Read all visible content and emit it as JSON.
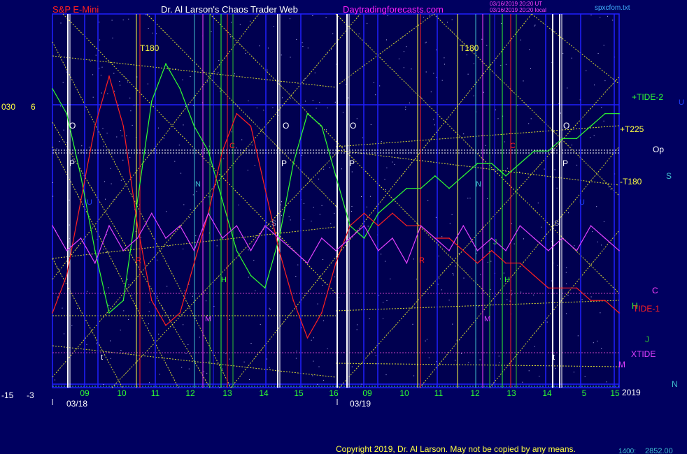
{
  "header": {
    "instrument": "S&P E-Mini",
    "site_title": "Dr. Al Larson's Chaos Trader Web",
    "site_url": "Daytradingforecasts.com",
    "timestamp_1": "03/16/2019 20:20 UT",
    "timestamp_2": "03/16/2019 20:20 local",
    "file_name": "spxcfom.txt"
  },
  "left_axis": {
    "top_labels": [
      "030",
      "6"
    ],
    "bottom_labels": [
      "-15",
      "-3"
    ]
  },
  "right_labels": {
    "tide2": "+TIDE-2",
    "t225": "+T225",
    "op": "Op",
    "t180": "-T180",
    "s": "S",
    "u": "U",
    "c": "C",
    "h": "H",
    "tide1": "TIDE-1",
    "j": "J",
    "xtide": "XTIDE",
    "m": "M",
    "year": "2019",
    "n": "N"
  },
  "x_axis": {
    "hour_labels": [
      "09",
      "10",
      "11",
      "12",
      "13",
      "14",
      "15",
      "16",
      "09",
      "10",
      "11",
      "12",
      "13",
      "14",
      "5",
      "15"
    ],
    "dates": [
      "03/18",
      "03/19"
    ]
  },
  "in_chart_labels": {
    "t180": "T180",
    "o": "O",
    "p": "P",
    "n": "N",
    "c": "C",
    "r": "R",
    "s": "S",
    "h": "H",
    "m": "M",
    "j": "J",
    "u": "U",
    "t": "t"
  },
  "footer": {
    "copyright": "Copyright 2019, Dr. Al Larson. May not be copied by any means.",
    "price": "2852.00",
    "price_prefix": "1400:"
  },
  "colors": {
    "background": "#000060",
    "frame": "#2020ff",
    "gann": "#d8d830",
    "tide2": "#30ff30",
    "tide1": "#ff2020",
    "xtide": "#e040ff",
    "title_red": "#ff2020",
    "site_magenta": "#ff20ff",
    "cyan": "#40d0e0"
  },
  "chart_data": {
    "type": "line",
    "series": [
      {
        "name": "+TIDE-2",
        "x": [
          0,
          5,
          10,
          15,
          20,
          25,
          30,
          35,
          40,
          45,
          50,
          55,
          60,
          65,
          70,
          75,
          80,
          85,
          90,
          95,
          100,
          105,
          110,
          115,
          120,
          125,
          130,
          135,
          140,
          145,
          150,
          155,
          160,
          165,
          170,
          175,
          180,
          185,
          190,
          195,
          200
        ],
        "y": [
          9,
          7,
          2,
          -4,
          -9,
          -8,
          0,
          8,
          11,
          9,
          6,
          4,
          0,
          -4,
          -6,
          -7,
          -3,
          3,
          7,
          6,
          2,
          -2,
          -3,
          -1,
          0,
          1,
          1,
          2,
          1,
          2,
          3,
          3,
          2,
          3,
          4,
          4,
          5,
          5,
          6,
          7,
          7
        ]
      },
      {
        "name": "TIDE-1",
        "x": [
          0,
          5,
          10,
          15,
          20,
          25,
          30,
          35,
          40,
          45,
          50,
          55,
          60,
          65,
          70,
          75,
          80,
          85,
          90,
          95,
          100,
          105,
          110,
          115,
          120,
          125,
          130,
          135,
          140,
          145,
          150,
          155,
          160,
          165,
          170,
          175,
          180,
          185,
          190,
          195,
          200
        ],
        "y": [
          -9,
          -6,
          0,
          6,
          10,
          6,
          -2,
          -8,
          -10,
          -9,
          -5,
          -1,
          4,
          7,
          6,
          1,
          -4,
          -8,
          -11,
          -9,
          -5,
          -2,
          -1,
          -2,
          -1,
          -2,
          -2,
          -3,
          -3,
          -4,
          -5,
          -4,
          -5,
          -5,
          -6,
          -7,
          -7,
          -7,
          -8,
          -8,
          -9
        ]
      },
      {
        "name": "XTIDE",
        "x": [
          0,
          5,
          10,
          15,
          20,
          25,
          30,
          35,
          40,
          45,
          50,
          55,
          60,
          65,
          70,
          75,
          80,
          85,
          90,
          95,
          100,
          105,
          110,
          115,
          120,
          125,
          130,
          135,
          140,
          145,
          150,
          155,
          160,
          165,
          170,
          175,
          180,
          185,
          190,
          195,
          200
        ],
        "y": [
          -2,
          -4,
          -3,
          -5,
          -2,
          -4,
          -3,
          -1,
          -3,
          -2,
          -4,
          -1,
          -3,
          -2,
          -4,
          -2,
          -3,
          -4,
          -5,
          -3,
          -4,
          -3,
          -2,
          -4,
          -3,
          -5,
          -2,
          -3,
          -4,
          -2,
          -4,
          -3,
          -4,
          -2,
          -3,
          -4,
          -3,
          -4,
          -2,
          -3,
          -4
        ]
      }
    ],
    "ylim": [
      -15,
      15
    ],
    "xlim": [
      0,
      200
    ],
    "grid": true,
    "legend": "right"
  }
}
